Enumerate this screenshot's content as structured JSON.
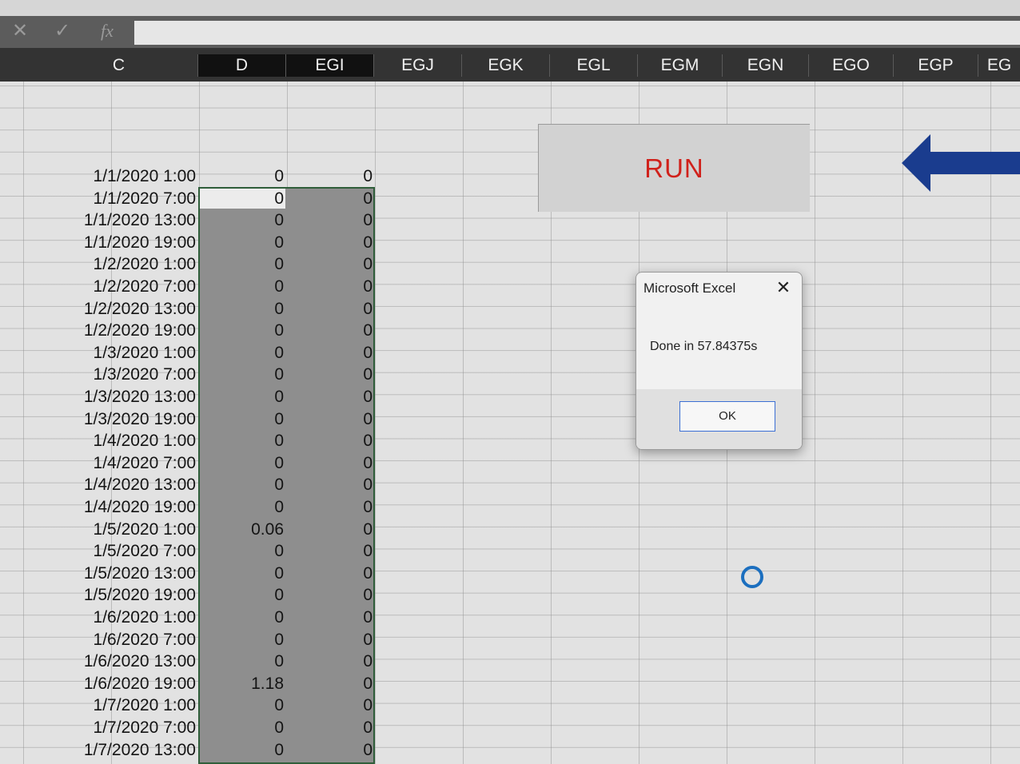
{
  "formula_bar": {
    "cancel_icon": "✕",
    "enter_icon": "✓",
    "fx_label": "fx",
    "value": ""
  },
  "column_headers": [
    "C",
    "D",
    "EGI",
    "EGJ",
    "EGK",
    "EGL",
    "EGM",
    "EGN",
    "EGO",
    "EGP",
    "EG"
  ],
  "rows": [
    {
      "c": "1/1/2020 1:00",
      "d": "0",
      "e": "0"
    },
    {
      "c": "1/1/2020 7:00",
      "d": "0",
      "e": "0"
    },
    {
      "c": "1/1/2020 13:00",
      "d": "0",
      "e": "0"
    },
    {
      "c": "1/1/2020 19:00",
      "d": "0",
      "e": "0"
    },
    {
      "c": "1/2/2020 1:00",
      "d": "0",
      "e": "0"
    },
    {
      "c": "1/2/2020 7:00",
      "d": "0",
      "e": "0"
    },
    {
      "c": "1/2/2020 13:00",
      "d": "0",
      "e": "0"
    },
    {
      "c": "1/2/2020 19:00",
      "d": "0",
      "e": "0"
    },
    {
      "c": "1/3/2020 1:00",
      "d": "0",
      "e": "0"
    },
    {
      "c": "1/3/2020 7:00",
      "d": "0",
      "e": "0"
    },
    {
      "c": "1/3/2020 13:00",
      "d": "0",
      "e": "0"
    },
    {
      "c": "1/3/2020 19:00",
      "d": "0",
      "e": "0"
    },
    {
      "c": "1/4/2020 1:00",
      "d": "0",
      "e": "0"
    },
    {
      "c": "1/4/2020 7:00",
      "d": "0",
      "e": "0"
    },
    {
      "c": "1/4/2020 13:00",
      "d": "0",
      "e": "0"
    },
    {
      "c": "1/4/2020 19:00",
      "d": "0",
      "e": "0"
    },
    {
      "c": "1/5/2020 1:00",
      "d": "0.06",
      "e": "0"
    },
    {
      "c": "1/5/2020 7:00",
      "d": "0",
      "e": "0"
    },
    {
      "c": "1/5/2020 13:00",
      "d": "0",
      "e": "0"
    },
    {
      "c": "1/5/2020 19:00",
      "d": "0",
      "e": "0"
    },
    {
      "c": "1/6/2020 1:00",
      "d": "0",
      "e": "0"
    },
    {
      "c": "1/6/2020 7:00",
      "d": "0",
      "e": "0"
    },
    {
      "c": "1/6/2020 13:00",
      "d": "0",
      "e": "0"
    },
    {
      "c": "1/6/2020 19:00",
      "d": "1.18",
      "e": "0"
    },
    {
      "c": "1/7/2020 1:00",
      "d": "0",
      "e": "0"
    },
    {
      "c": "1/7/2020 7:00",
      "d": "0",
      "e": "0"
    },
    {
      "c": "1/7/2020 13:00",
      "d": "0",
      "e": "0"
    }
  ],
  "run_button": {
    "label": "RUN",
    "color": "#d0211b"
  },
  "arrow": {
    "icon": "left-arrow-icon",
    "color": "#1a3c8e"
  },
  "dialog": {
    "title": "Microsoft Excel",
    "close_icon": "✕",
    "message": "Done in 57.84375s",
    "ok_label": "OK"
  },
  "busy_indicator": {
    "icon": "busy-ring-icon",
    "color": "#1c6fbf"
  }
}
